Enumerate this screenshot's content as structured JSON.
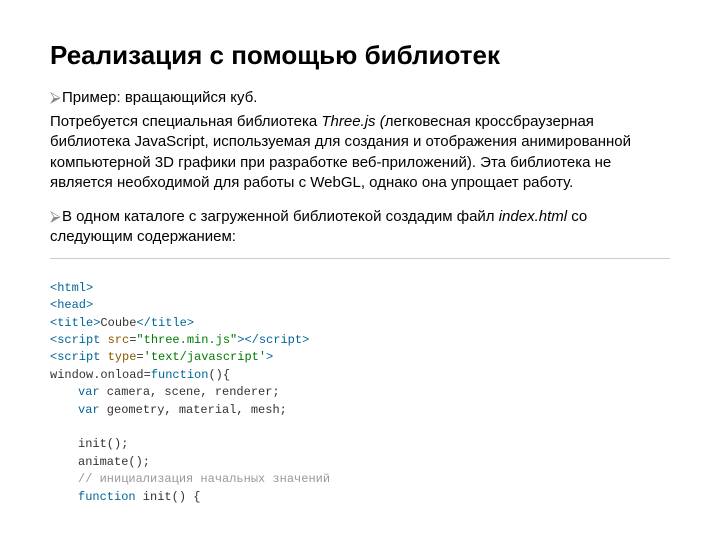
{
  "title": "Реализация с помощью библиотек",
  "bullet1_prefix": "Пример: вращающийся куб.",
  "para1_a": "Потребуется специальная библиотека ",
  "para1_threejs": "Three.js (",
  "para1_b": "легковесная кроссбраузерная библиотека JavaScript, используемая для создания и отображения анимированной компьютерной 3D графики при разработке веб-приложений). Эта библиотека не является необходимой для работы с WebGL, однако она упрощает работу.",
  "bullet2_a": "В одном каталоге с загруженной библиотекой создадим файл ",
  "bullet2_file": "index.html",
  "bullet2_b": " со следующим содержанием:",
  "code": {
    "l1_a": "<html>",
    "l2_a": "<head>",
    "l3_a": "<title>",
    "l3_b": "Coube",
    "l3_c": "</title>",
    "l4_a": "<script ",
    "l4_b": "src",
    "l4_c": "=",
    "l4_d": "\"three.min.js\"",
    "l4_e": "></script",
    "l4_f": ">",
    "l5_a": "<script ",
    "l5_b": "type",
    "l5_c": "=",
    "l5_d": "'text/javascript'",
    "l5_e": ">",
    "l6_a": "window.onload=",
    "l6_b": "function",
    "l6_c": "(){",
    "l7_a": "var",
    "l7_b": " camera, scene, renderer;",
    "l8_a": "var",
    "l8_b": " geometry, material, mesh;",
    "blank": "",
    "l9": "init();",
    "l10": "animate();",
    "l11": "// инициализация начальных значений",
    "l12_a": "function",
    "l12_b": " init() {"
  }
}
